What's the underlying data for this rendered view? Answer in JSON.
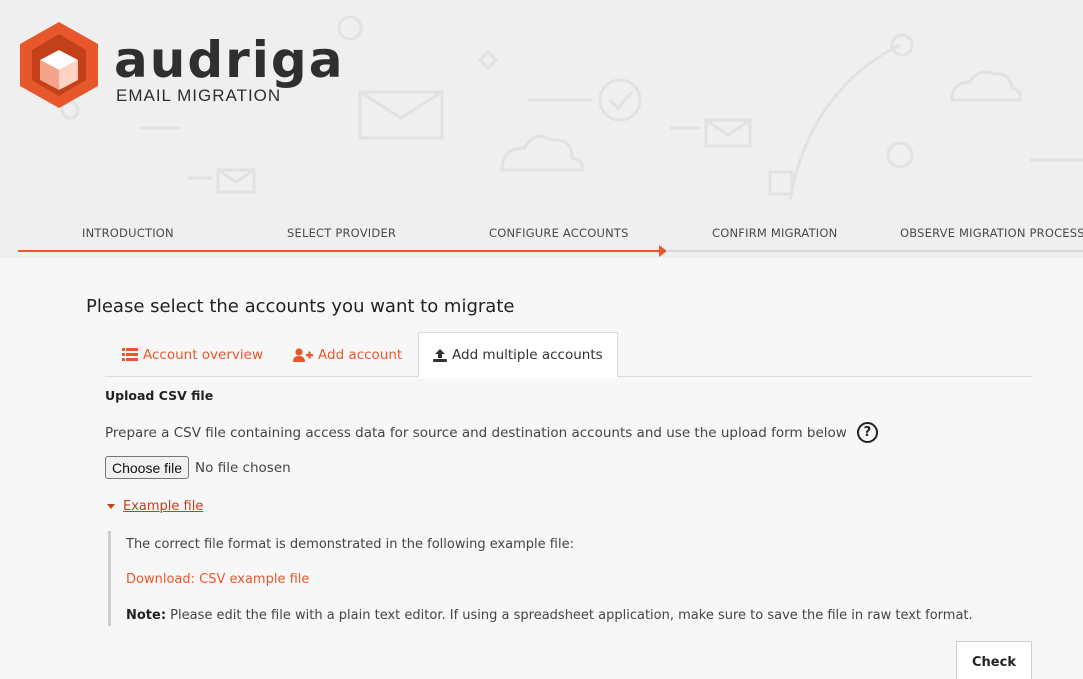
{
  "brand": {
    "name": "audriga",
    "tagline": "EMAIL MIGRATION"
  },
  "steps": [
    {
      "label": "INTRODUCTION"
    },
    {
      "label": "SELECT PROVIDER"
    },
    {
      "label": "CONFIGURE ACCOUNTS"
    },
    {
      "label": "CONFIRM MIGRATION"
    },
    {
      "label": "OBSERVE MIGRATION PROCESS"
    }
  ],
  "current_step": 3,
  "page_title": "Please select the accounts you want to migrate",
  "tabs": [
    {
      "label": "Account overview",
      "icon": "list-icon"
    },
    {
      "label": "Add account",
      "icon": "add-user-icon"
    },
    {
      "label": "Add multiple accounts",
      "icon": "upload-icon",
      "active": true
    }
  ],
  "upload": {
    "title": "Upload CSV file",
    "description": "Prepare a CSV file containing access data for source and destination accounts and use the upload form below",
    "help_icon": "question-circle-icon",
    "choose_label": "Choose file",
    "no_file_text": "No file chosen"
  },
  "example": {
    "toggle_label": "Example file",
    "expanded": true,
    "intro": "The correct file format is demonstrated in the following example file:",
    "download_label": "Download: CSV example file",
    "note_label": "Note:",
    "note_text": " Please edit the file with a plain text editor. If using a spreadsheet application, make sure to save the file in raw text format."
  },
  "check_label": "Check",
  "colors": {
    "accent": "#e8572b",
    "link_dark": "#c43f12",
    "background": "#f7f7f7"
  }
}
